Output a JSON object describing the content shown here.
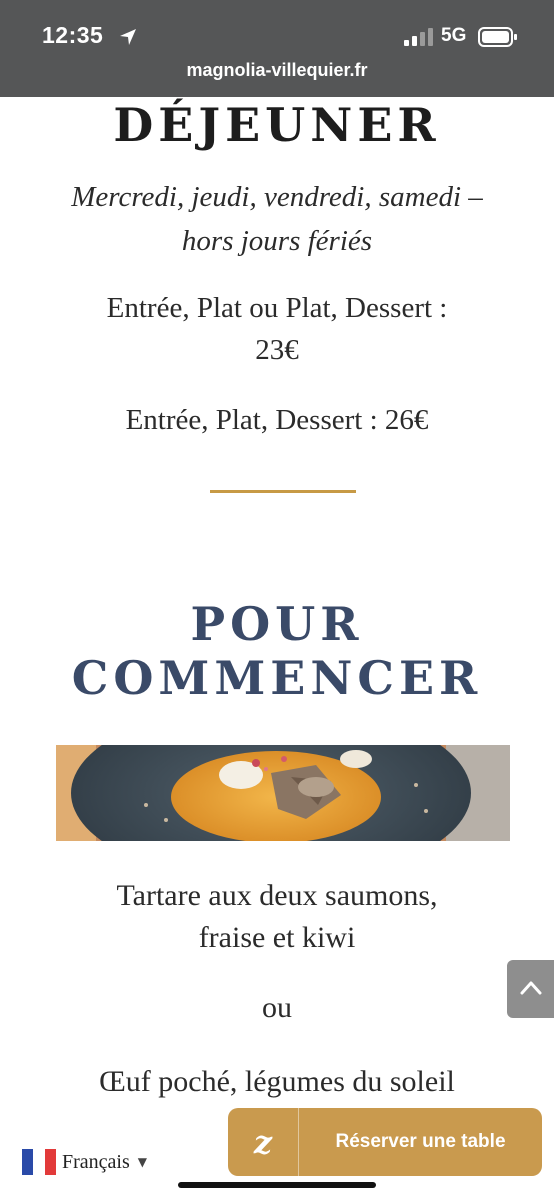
{
  "status_bar": {
    "time": "12:35",
    "network": "5G",
    "icons": [
      "location-arrow-icon",
      "signal-icon",
      "battery-icon"
    ]
  },
  "browser": {
    "url": "magnolia-villequier.fr"
  },
  "menu": {
    "lunch": {
      "title": "DÉJEUNER",
      "days_line1": "Mercredi, jeudi, vendredi, samedi –",
      "days_line2": "hors jours fériés",
      "price1_line1": "Entrée, Plat ou Plat, Dessert :",
      "price1_line2": "23€",
      "price2": "Entrée, Plat, Dessert : 26€"
    },
    "starters": {
      "title_line1": "POUR",
      "title_line2": "COMMENCER",
      "dish1_line1": "Tartare aux deux saumons,",
      "dish1_line2": "fraise et kiwi",
      "or_label": "ou",
      "dish2": "Œuf poché, légumes du soleil"
    }
  },
  "language": {
    "label": "Français",
    "flag": "france-flag-icon"
  },
  "reserve": {
    "logo": "z",
    "label": "Réserver une table"
  },
  "colors": {
    "accent_gold": "#c79a45",
    "reserve_bg": "#c99a4e",
    "heading_blue": "#3a4a68",
    "topbar_gray": "#555657"
  }
}
